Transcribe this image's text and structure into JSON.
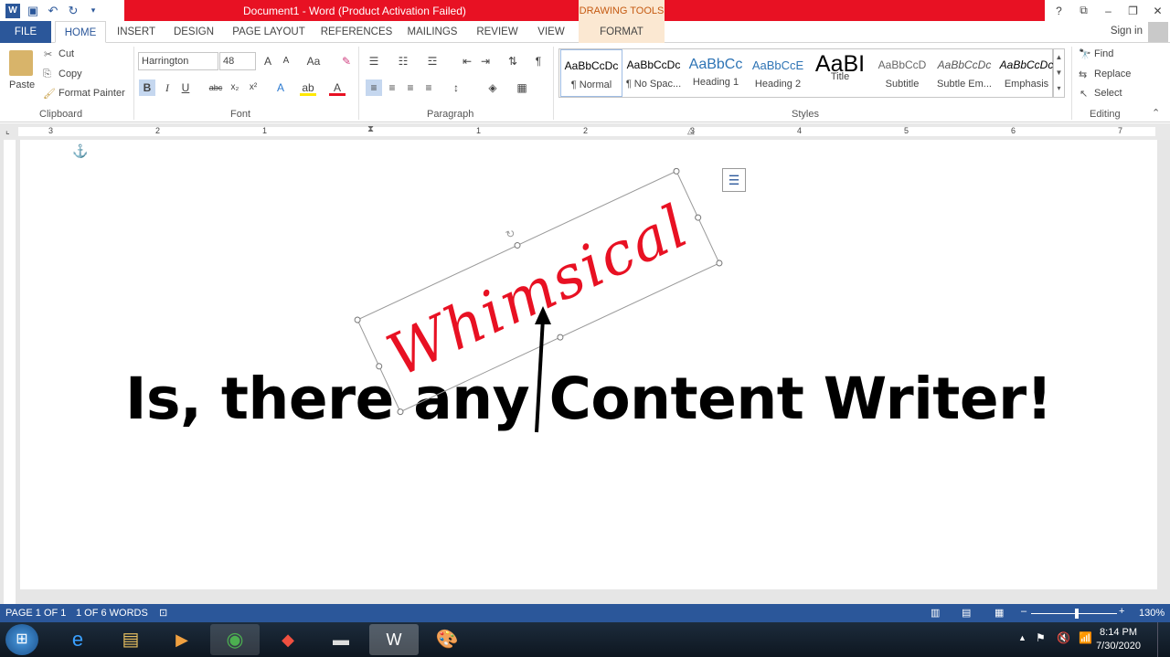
{
  "window": {
    "title": "Document1 - Word (Product Activation Failed)",
    "drawing_tools": "DRAWING TOOLS",
    "controls": [
      "?",
      "⧉",
      "–",
      "❐",
      "✕"
    ]
  },
  "tabs": [
    "FILE",
    "HOME",
    "INSERT",
    "DESIGN",
    "PAGE LAYOUT",
    "REFERENCES",
    "MAILINGS",
    "REVIEW",
    "VIEW",
    "FORMAT"
  ],
  "account": {
    "signin": "Sign in"
  },
  "clipboard": {
    "paste": "Paste",
    "cut": "Cut",
    "copy": "Copy",
    "format_painter": "Format Painter",
    "label": "Clipboard"
  },
  "font": {
    "name": "Harrington",
    "size": "48",
    "label": "Font"
  },
  "paragraph": {
    "label": "Paragraph"
  },
  "styles": {
    "label": "Styles",
    "items": [
      {
        "sample": "AaBbCcDc",
        "name": "¶ Normal"
      },
      {
        "sample": "AaBbCcDc",
        "name": "¶ No Spac..."
      },
      {
        "sample": "AaBbCc",
        "name": "Heading 1"
      },
      {
        "sample": "AaBbCcE",
        "name": "Heading 2"
      },
      {
        "sample": "AaBI",
        "name": "Title"
      },
      {
        "sample": "AaBbCcD",
        "name": "Subtitle"
      },
      {
        "sample": "AaBbCcDc",
        "name": "Subtle Em..."
      },
      {
        "sample": "AaBbCcDc",
        "name": "Emphasis"
      }
    ]
  },
  "editing": {
    "find": "Find",
    "replace": "Replace",
    "select": "Select",
    "label": "Editing"
  },
  "ruler": {
    "numbers": [
      "3",
      "2",
      "1",
      "1",
      "2",
      "3",
      "4",
      "5",
      "6",
      "7"
    ]
  },
  "document": {
    "wordart": "Whimsical",
    "body_text": "Is, there any Content Writer!"
  },
  "status": {
    "page": "PAGE 1 OF 1",
    "words": "1 OF 6 WORDS",
    "zoom": "130%"
  },
  "clock": {
    "time": "8:14 PM",
    "date": "7/30/2020"
  },
  "colors": {
    "accent": "#2b579a",
    "title_red": "#e81123",
    "wordart_red": "#e81123"
  }
}
